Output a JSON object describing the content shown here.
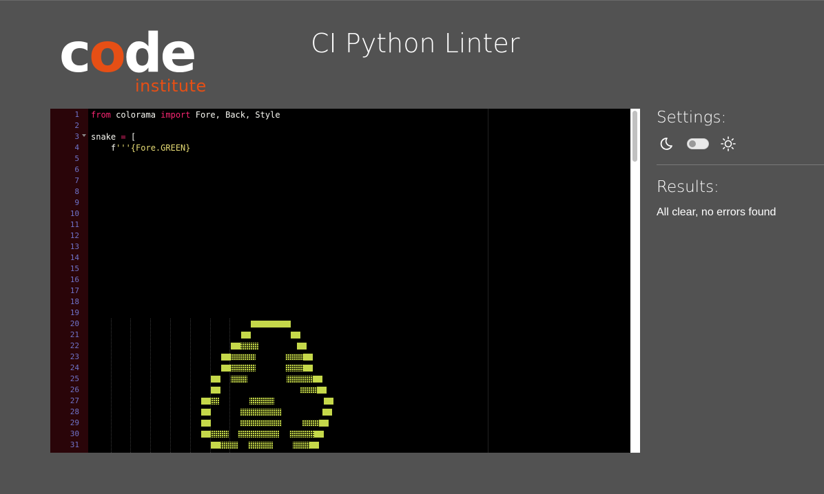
{
  "brand": {
    "logo_word_start": "c",
    "logo_word_o": "o",
    "logo_word_end": "de",
    "logo_sub": "institute"
  },
  "header": {
    "title": "CI Python Linter"
  },
  "editor": {
    "line_numbers": [
      "1",
      "2",
      "3",
      "4",
      "5",
      "6",
      "7",
      "8",
      "9",
      "10",
      "11",
      "12",
      "13",
      "14",
      "15",
      "16",
      "17",
      "18",
      "19",
      "20",
      "21",
      "22",
      "23",
      "24",
      "25",
      "26",
      "27",
      "28",
      "29",
      "30",
      "31"
    ],
    "lines": [
      {
        "t1": "from",
        "t2": " colorama ",
        "t3": "import",
        "t4": " Fore, Back, Style"
      },
      {
        "plain": ""
      },
      {
        "a": "snake ",
        "b": "=",
        "c": " ["
      },
      {
        "a": "    f",
        "b": "'''{Fore.GREEN}"
      }
    ],
    "art_color": "#c5d84a"
  },
  "settings": {
    "heading": "Settings:",
    "dark_icon": "moon-icon",
    "light_icon": "sun-icon",
    "theme_toggle_on": false
  },
  "results": {
    "heading": "Results:",
    "message": "All clear, no errors found"
  }
}
